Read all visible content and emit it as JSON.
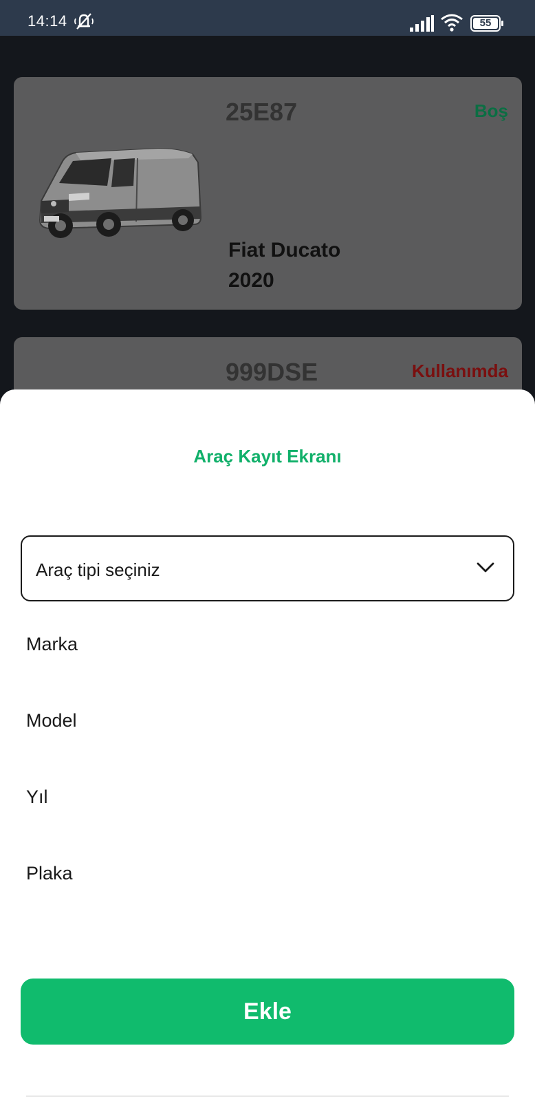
{
  "status_bar": {
    "time": "14:14",
    "battery": "55",
    "icons": [
      "mute-icon",
      "signal-icon",
      "wifi-icon",
      "battery-icon"
    ]
  },
  "vehicles": [
    {
      "plate": "25E87",
      "status": "Boş",
      "model": "Fiat Ducato",
      "year": "2020",
      "status_color": "#0b6e43"
    },
    {
      "plate": "999DSE",
      "status": "Kullanımda",
      "status_color": "#7a0f0f"
    }
  ],
  "sheet": {
    "title": "Araç Kayıt Ekranı",
    "vehicle_type_select": "Araç tipi seçiniz",
    "fields": {
      "brand": "Marka",
      "model": "Model",
      "year": "Yıl",
      "plate": "Plaka"
    },
    "submit_label": "Ekle"
  },
  "colors": {
    "accent": "#10bb6d",
    "title": "#11b06a",
    "status_bar": "#2d3a4c"
  }
}
